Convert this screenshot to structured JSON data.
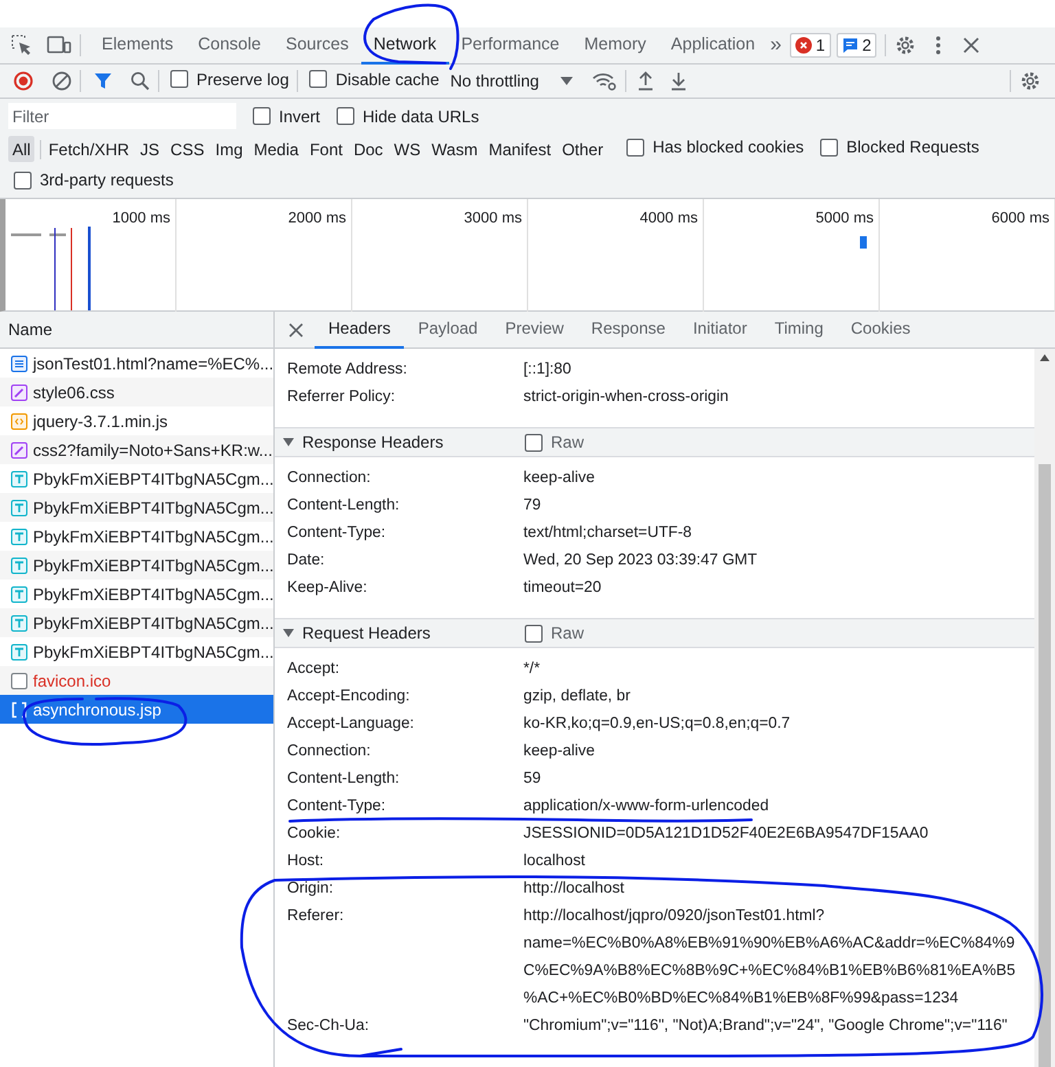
{
  "main_tabs": [
    {
      "label": "Elements",
      "selected": false
    },
    {
      "label": "Console",
      "selected": false
    },
    {
      "label": "Sources",
      "selected": false
    },
    {
      "label": "Network",
      "selected": true
    },
    {
      "label": "Performance",
      "selected": false
    },
    {
      "label": "Memory",
      "selected": false
    },
    {
      "label": "Application",
      "selected": false
    }
  ],
  "overflow": "»",
  "badges": [
    {
      "kind": "error",
      "count": "1"
    },
    {
      "kind": "message",
      "count": "2"
    }
  ],
  "toolbar": {
    "preserve_log": {
      "label": "Preserve log",
      "checked": false
    },
    "disable_cache": {
      "label": "Disable cache",
      "checked": false
    },
    "throttling": "No throttling"
  },
  "filter": {
    "placeholder": "Filter",
    "invert": {
      "label": "Invert",
      "checked": false
    },
    "hide_data_urls": {
      "label": "Hide data URLs",
      "checked": false
    }
  },
  "types": [
    {
      "label": "All",
      "selected": true
    },
    {
      "label": "Fetch/XHR",
      "selected": false
    },
    {
      "label": "JS",
      "selected": false
    },
    {
      "label": "CSS",
      "selected": false
    },
    {
      "label": "Img",
      "selected": false
    },
    {
      "label": "Media",
      "selected": false
    },
    {
      "label": "Font",
      "selected": false
    },
    {
      "label": "Doc",
      "selected": false
    },
    {
      "label": "WS",
      "selected": false
    },
    {
      "label": "Wasm",
      "selected": false
    },
    {
      "label": "Manifest",
      "selected": false
    },
    {
      "label": "Other",
      "selected": false
    }
  ],
  "type_options": [
    {
      "label": "Has blocked cookies",
      "checked": false
    },
    {
      "label": "Blocked Requests",
      "checked": false
    }
  ],
  "third_party": {
    "label": "3rd-party requests",
    "checked": false
  },
  "timeline": {
    "ticks": [
      "1000 ms",
      "2000 ms",
      "3000 ms",
      "4000 ms",
      "5000 ms",
      "6000 ms"
    ]
  },
  "requests": {
    "header": "Name",
    "items": [
      {
        "name": "jsonTest01.html?name=%EC%...",
        "kind": "doc",
        "failed": false,
        "selected": false
      },
      {
        "name": "style06.css",
        "kind": "css",
        "failed": false,
        "selected": false
      },
      {
        "name": "jquery-3.7.1.min.js",
        "kind": "js",
        "failed": false,
        "selected": false
      },
      {
        "name": "css2?family=Noto+Sans+KR:w...",
        "kind": "css",
        "failed": false,
        "selected": false
      },
      {
        "name": "PbykFmXiEBPT4ITbgNA5Cgm...",
        "kind": "font",
        "failed": false,
        "selected": false
      },
      {
        "name": "PbykFmXiEBPT4ITbgNA5Cgm...",
        "kind": "font",
        "failed": false,
        "selected": false
      },
      {
        "name": "PbykFmXiEBPT4ITbgNA5Cgm...",
        "kind": "font",
        "failed": false,
        "selected": false
      },
      {
        "name": "PbykFmXiEBPT4ITbgNA5Cgm...",
        "kind": "font",
        "failed": false,
        "selected": false
      },
      {
        "name": "PbykFmXiEBPT4ITbgNA5Cgm...",
        "kind": "font",
        "failed": false,
        "selected": false
      },
      {
        "name": "PbykFmXiEBPT4ITbgNA5Cgm...",
        "kind": "font",
        "failed": false,
        "selected": false
      },
      {
        "name": "PbykFmXiEBPT4ITbgNA5Cgm...",
        "kind": "font",
        "failed": false,
        "selected": false
      },
      {
        "name": "favicon.ico",
        "kind": "other",
        "failed": true,
        "selected": false
      },
      {
        "name": "asynchronous.jsp",
        "kind": "xhr",
        "failed": false,
        "selected": true
      }
    ]
  },
  "detail_tabs": [
    {
      "label": "Headers",
      "selected": true
    },
    {
      "label": "Payload",
      "selected": false
    },
    {
      "label": "Preview",
      "selected": false
    },
    {
      "label": "Response",
      "selected": false
    },
    {
      "label": "Initiator",
      "selected": false
    },
    {
      "label": "Timing",
      "selected": false
    },
    {
      "label": "Cookies",
      "selected": false
    }
  ],
  "general": [
    {
      "name": "Remote Address:",
      "value": "[::1]:80"
    },
    {
      "name": "Referrer Policy:",
      "value": "strict-origin-when-cross-origin"
    }
  ],
  "sections": [
    {
      "title": "Response Headers",
      "expanded": true,
      "raw": {
        "label": "Raw",
        "checked": false
      },
      "headers": [
        {
          "name": "Connection:",
          "value": "keep-alive"
        },
        {
          "name": "Content-Length:",
          "value": "79"
        },
        {
          "name": "Content-Type:",
          "value": "text/html;charset=UTF-8"
        },
        {
          "name": "Date:",
          "value": "Wed, 20 Sep 2023 03:39:47 GMT"
        },
        {
          "name": "Keep-Alive:",
          "value": "timeout=20"
        }
      ]
    },
    {
      "title": "Request Headers",
      "expanded": true,
      "raw": {
        "label": "Raw",
        "checked": false
      },
      "headers": [
        {
          "name": "Accept:",
          "value": "*/*"
        },
        {
          "name": "Accept-Encoding:",
          "value": "gzip, deflate, br"
        },
        {
          "name": "Accept-Language:",
          "value": "ko-KR,ko;q=0.9,en-US;q=0.8,en;q=0.7"
        },
        {
          "name": "Connection:",
          "value": "keep-alive"
        },
        {
          "name": "Content-Length:",
          "value": "59"
        },
        {
          "name": "Content-Type:",
          "value": "application/x-www-form-urlencoded"
        },
        {
          "name": "Cookie:",
          "value": "JSESSIONID=0D5A121D1D52F40E2E6BA9547DF15AA0"
        },
        {
          "name": "Host:",
          "value": "localhost"
        },
        {
          "name": "Origin:",
          "value": "http://localhost"
        },
        {
          "name": "Referer:",
          "value": "http://localhost/jqpro/0920/jsonTest01.html?name=%EC%B0%A8%EB%91%90%EB%A6%AC&addr=%EC%84%9C%EC%9A%B8%EC%8B%9C+%EC%84%B1%EB%B6%81%EA%B5%AC+%EC%B0%BD%EC%84%B1%EB%8F%99&pass=1234"
        },
        {
          "name": "Sec-Ch-Ua:",
          "value": "\"Chromium\";v=\"116\", \"Not)A;Brand\";v=\"24\", \"Google Chrome\";v=\"116\""
        }
      ]
    }
  ]
}
